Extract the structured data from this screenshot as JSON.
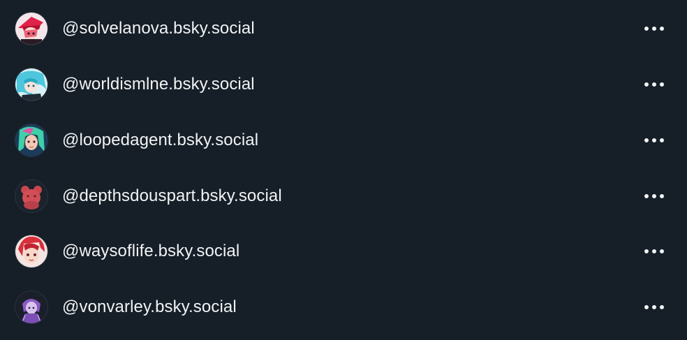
{
  "accounts": [
    {
      "handle": "@solvelanova.bsky.social",
      "avatar_icon": "avatar-red-hat-character",
      "more_icon": "more-options-icon"
    },
    {
      "handle": "@worldismlne.bsky.social",
      "avatar_icon": "avatar-cyan-hair-character",
      "more_icon": "more-options-icon"
    },
    {
      "handle": "@loopedagent.bsky.social",
      "avatar_icon": "avatar-teal-hair-character",
      "more_icon": "more-options-icon"
    },
    {
      "handle": "@depthsdouspart.bsky.social",
      "avatar_icon": "avatar-red-bear",
      "more_icon": "more-options-icon"
    },
    {
      "handle": "@waysoflife.bsky.social",
      "avatar_icon": "avatar-red-hair-character",
      "more_icon": "more-options-icon"
    },
    {
      "handle": "@vonvarley.bsky.social",
      "avatar_icon": "avatar-purple-character",
      "more_icon": "more-options-icon"
    }
  ],
  "colors": {
    "background": "#161e27",
    "text": "#f1f3f5",
    "icon": "#f1f3f5"
  }
}
